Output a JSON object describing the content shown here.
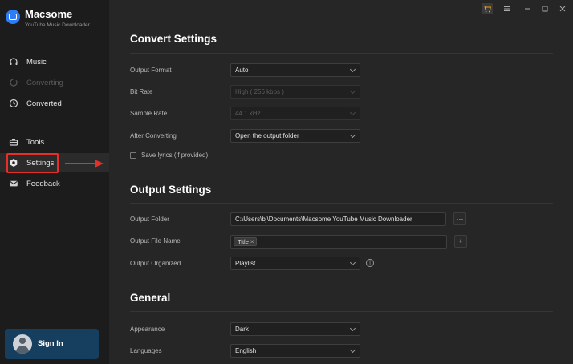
{
  "app": {
    "name": "Macsome",
    "subtitle": "YouTube Music Downloader"
  },
  "sidebar": {
    "items": [
      {
        "label": "Music",
        "icon": "headphones-icon",
        "disabled": false
      },
      {
        "label": "Converting",
        "icon": "sync-icon",
        "disabled": true
      },
      {
        "label": "Converted",
        "icon": "clock-icon",
        "disabled": false
      },
      {
        "label": "Tools",
        "icon": "toolbox-icon",
        "disabled": false
      },
      {
        "label": "Settings",
        "icon": "gear-icon",
        "active": true
      },
      {
        "label": "Feedback",
        "icon": "mail-icon",
        "disabled": false
      }
    ],
    "signin": {
      "label": "Sign In"
    }
  },
  "colors": {
    "accent": "#2e7cf6",
    "highlight": "#e5302a",
    "signin_bg": "#163e5e",
    "cart_icon": "#f39c12"
  },
  "convert": {
    "title": "Convert Settings",
    "output_format": {
      "label": "Output Format",
      "value": "Auto"
    },
    "bit_rate": {
      "label": "Bit Rate",
      "value": "High ( 256 kbps )"
    },
    "sample_rate": {
      "label": "Sample Rate",
      "value": "44.1 kHz"
    },
    "after_converting": {
      "label": "After Converting",
      "value": "Open the output folder"
    },
    "save_lyrics": {
      "label": "Save lyrics (if provided)"
    }
  },
  "output": {
    "title": "Output Settings",
    "folder": {
      "label": "Output Folder",
      "value": "C:\\Users\\bj\\Documents\\Macsome YouTube Music Downloader",
      "browse": "···"
    },
    "file_name": {
      "label": "Output File Name",
      "tag": "Title",
      "tag_remove": "×",
      "add": "+"
    },
    "organized": {
      "label": "Output Organized",
      "value": "Playlist",
      "info": "i"
    }
  },
  "general": {
    "title": "General",
    "appearance": {
      "label": "Appearance",
      "value": "Dark"
    },
    "languages": {
      "label": "Languages",
      "value": "English"
    }
  }
}
